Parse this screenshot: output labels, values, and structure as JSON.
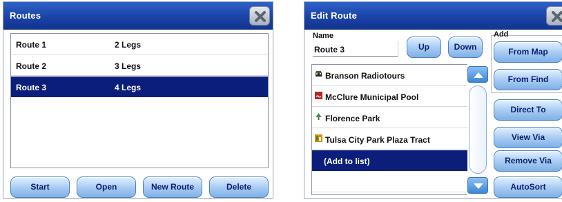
{
  "routes_window": {
    "title": "Routes",
    "routes": [
      {
        "name": "Route 1",
        "legs": "2 Legs",
        "selected": false
      },
      {
        "name": "Route 2",
        "legs": "3 Legs",
        "selected": false
      },
      {
        "name": "Route 3",
        "legs": "4 Legs",
        "selected": true
      }
    ],
    "buttons": {
      "start": "Start",
      "open": "Open",
      "new_route": "New Route",
      "delete": "Delete"
    }
  },
  "edit_route_window": {
    "title": "Edit Route",
    "name_label": "Name",
    "name_value": "Route 3",
    "buttons": {
      "up": "Up",
      "down": "Down",
      "from_map": "From Map",
      "from_find": "From Find",
      "direct_to": "Direct To",
      "view_via": "View Via",
      "remove_via": "Remove Via",
      "autosort": "AutoSort"
    },
    "add_label": "Add",
    "vias": [
      {
        "name": "Branson Radiotours",
        "icon": "car-icon",
        "color": "#2a2a2a"
      },
      {
        "name": "McClure Municipal Pool",
        "icon": "pool-icon",
        "color": "#b02a2a"
      },
      {
        "name": "Florence Park",
        "icon": "tree-icon",
        "color": "#2aa045"
      },
      {
        "name": "Tulsa City Park Plaza Tract",
        "icon": "shop-icon",
        "color": "#d88a1a"
      },
      {
        "name": "(Add to list)",
        "icon": "",
        "selected": true
      }
    ]
  },
  "colors": {
    "titlebar": "#1a43a6",
    "selection": "#0b1f7a",
    "button": "#a9cdf3"
  }
}
